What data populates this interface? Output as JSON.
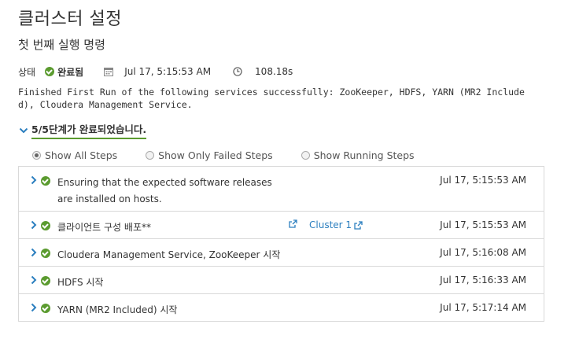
{
  "page": {
    "title": "클러스터 설정",
    "subtitle": "첫 번째 실행 명령"
  },
  "status": {
    "label": "상태",
    "value": "완료됨",
    "date": "Jul 17, 5:15:53 AM",
    "duration": "108.18s"
  },
  "run_message": "Finished First Run of the following services successfully: ZooKeeper, HDFS, YARN (MR2 Included), Cloudera Management Service.",
  "steps_summary": "5/5단계가 완료되었습니다.",
  "filters": [
    {
      "label": "Show All Steps",
      "selected": true
    },
    {
      "label": "Show Only Failed Steps",
      "selected": false
    },
    {
      "label": "Show Running Steps",
      "selected": false
    }
  ],
  "steps": [
    {
      "description": "Ensuring that the expected software releases are installed on hosts.",
      "time": "Jul 17, 5:15:53 AM"
    },
    {
      "description": "클라이언트 구성 배포**",
      "link": "Cluster 1",
      "time": "Jul 17, 5:15:53 AM"
    },
    {
      "description": "Cloudera Management Service, ZooKeeper 시작",
      "time": "Jul 17, 5:16:08 AM"
    },
    {
      "description": "HDFS 시작",
      "time": "Jul 17, 5:16:33 AM"
    },
    {
      "description": "YARN (MR2 Included) 시작",
      "time": "Jul 17, 5:17:14 AM"
    }
  ],
  "colors": {
    "success": "#5b9b2f",
    "link": "#2c7fbf"
  }
}
